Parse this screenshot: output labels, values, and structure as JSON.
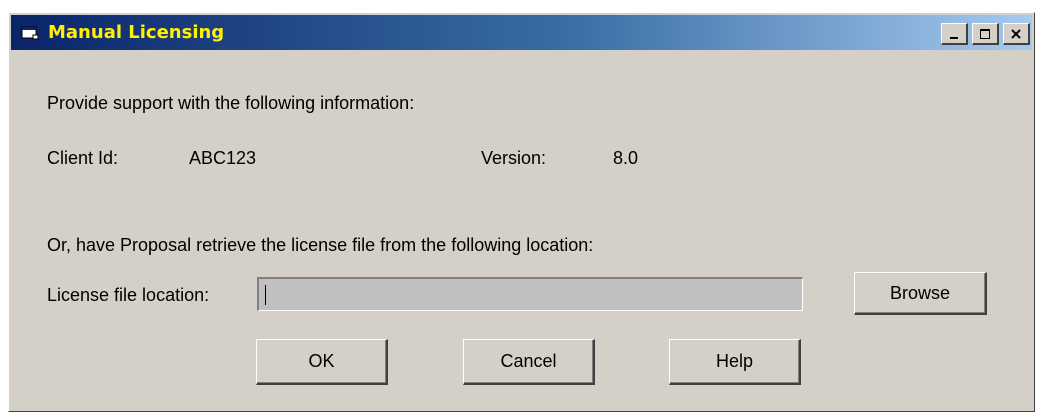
{
  "window": {
    "title": "Manual Licensing",
    "title_color": "#fff100",
    "titlebar_gradient": [
      "#0a246a",
      "#a6caf0"
    ],
    "face_color": "#d4d0c8",
    "controls": [
      "minimize-icon",
      "maximize-icon",
      "close-icon"
    ]
  },
  "content": {
    "instruction": "Provide support with the following information:",
    "client_id_label": "Client Id:",
    "client_id_value": "ABC123",
    "version_label": "Version:",
    "version_value": "8.0",
    "retrieve_text": "Or, have Proposal retrieve the license file from the following location:",
    "license_location_label": "License file location:",
    "license_location_value": ""
  },
  "buttons": {
    "browse": "Browse",
    "ok": "OK",
    "cancel": "Cancel",
    "help": "Help"
  }
}
